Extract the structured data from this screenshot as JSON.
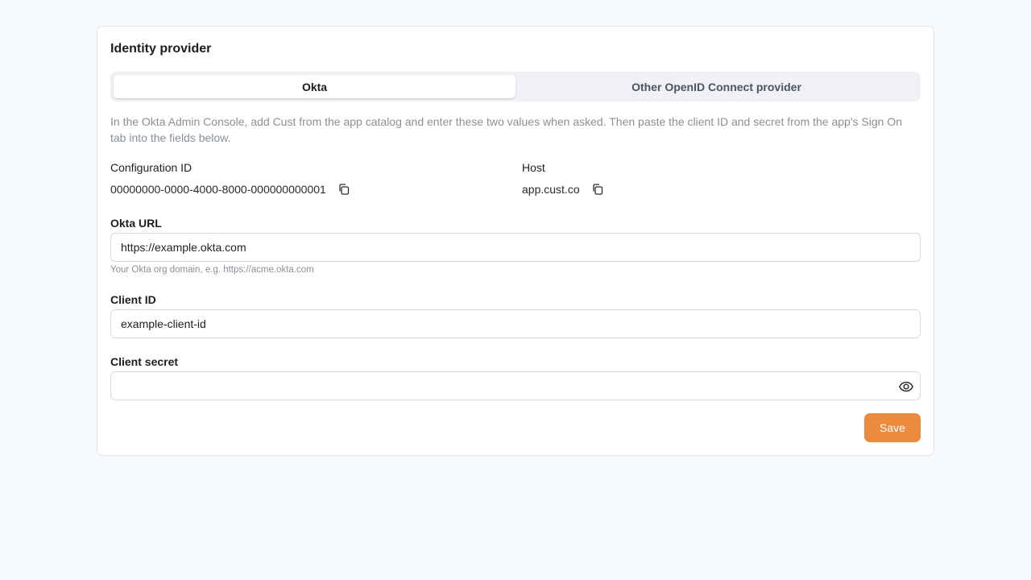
{
  "card": {
    "title": "Identity provider"
  },
  "tabs": [
    {
      "label": "Okta",
      "active": true
    },
    {
      "label": "Other OpenID Connect provider",
      "active": false
    }
  ],
  "help_text": "In the Okta Admin Console, add Cust from the app catalog and enter these two values when asked. Then paste the client ID and secret from the app's Sign On tab into the fields below.",
  "configuration": {
    "label": "Configuration ID",
    "value": "00000000-0000-4000-8000-000000000001",
    "copy_icon": "copy-icon"
  },
  "host": {
    "label": "Host",
    "value": "app.cust.co",
    "copy_icon": "copy-icon"
  },
  "okta_url": {
    "label": "Okta URL",
    "value": "https://example.okta.com",
    "hint": "Your Okta org domain, e.g. https://acme.okta.com"
  },
  "client_id": {
    "label": "Client ID",
    "value": "example-client-id"
  },
  "client_secret": {
    "label": "Client secret",
    "value": "",
    "reveal_icon": "eye-icon"
  },
  "save_label": "Save",
  "colors": {
    "accent": "#ec8a3d",
    "background": "#f5f8fc",
    "muted_text": "#8a9099"
  }
}
